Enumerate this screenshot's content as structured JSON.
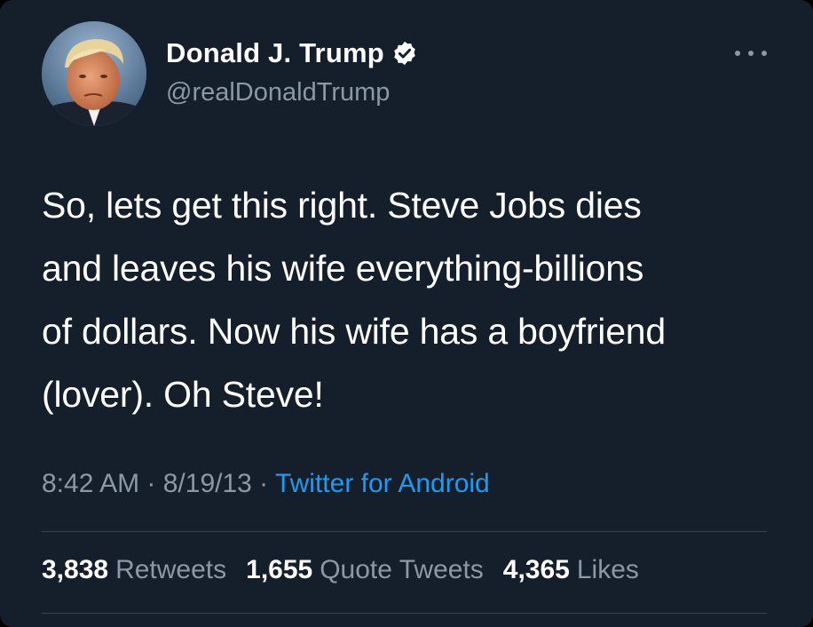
{
  "tweet": {
    "display_name": "Donald J. Trump",
    "handle": "@realDonaldTrump",
    "text": "So, lets get this right. Steve Jobs dies\nand leaves his wife everything-billions\nof dollars. Now his wife has a boyfriend\n(lover). Oh Steve!",
    "time": "8:42 AM",
    "separator": " · ",
    "date": "8/19/13",
    "source": "Twitter for Android"
  },
  "stats": {
    "retweets_count": "3,838",
    "retweets_label": "Retweets",
    "quotes_count": "1,655",
    "quotes_label": "Quote Tweets",
    "likes_count": "4,365",
    "likes_label": "Likes"
  },
  "icons": {
    "verified": "verified-badge-icon",
    "more": "more-options-icon",
    "avatar": "profile-avatar"
  },
  "colors": {
    "background": "#151f2b",
    "primary_text": "#ffffff",
    "secondary_text": "#8b98a5",
    "link": "#1d9bf0",
    "divider": "#38444d"
  }
}
